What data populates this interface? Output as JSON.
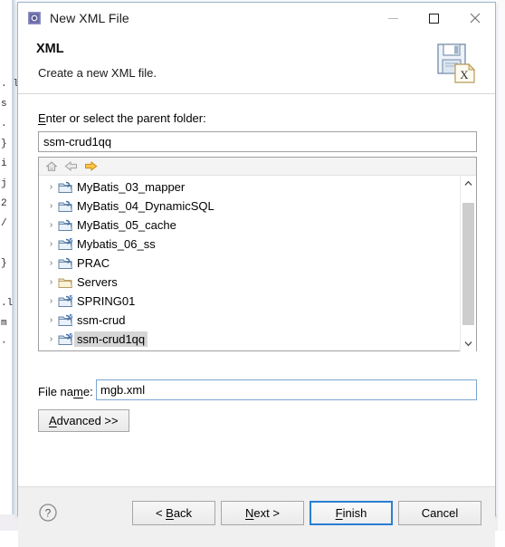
{
  "backdrop": {
    "lines": [
      ". l",
      "s",
      ".",
      "}",
      "",
      "i",
      "j",
      "2",
      "/",
      "",
      "}",
      "",
      "",
      ".l",
      "m",
      "·"
    ]
  },
  "window": {
    "icon": "xml-file-icon",
    "title": "New XML File",
    "controls": {
      "minimize": "minimize-icon",
      "maximize": "maximize-icon",
      "close": "close-icon"
    }
  },
  "header": {
    "title": "XML",
    "description": "Create a new XML file.",
    "icon": "xml-save-banner-icon"
  },
  "parent_folder": {
    "label_prefix": "E",
    "label_rest": "nter or select the parent folder:",
    "value": "ssm-crud1qq"
  },
  "tree_toolbar": {
    "home": "home-icon",
    "back": "back-arrow-icon",
    "forward": "forward-arrow-icon"
  },
  "tree": {
    "items": [
      {
        "label": "MyBatis_03_mapper",
        "icon": "java-project-folder-icon",
        "badge": false,
        "selected": false,
        "twisty": "›"
      },
      {
        "label": "MyBatis_04_DynamicSQL",
        "icon": "java-project-folder-icon",
        "badge": false,
        "selected": false,
        "twisty": "›"
      },
      {
        "label": "MyBatis_05_cache",
        "icon": "java-project-folder-icon",
        "badge": false,
        "selected": false,
        "twisty": "›"
      },
      {
        "label": "Mybatis_06_ss",
        "icon": "java-project-folder-icon",
        "badge": true,
        "selected": false,
        "twisty": "›"
      },
      {
        "label": "PRAC",
        "icon": "java-project-folder-icon",
        "badge": false,
        "selected": false,
        "twisty": "›"
      },
      {
        "label": "Servers",
        "icon": "plain-folder-icon",
        "badge": false,
        "selected": false,
        "twisty": "›"
      },
      {
        "label": "SPRING01",
        "icon": "java-project-folder-icon",
        "badge": true,
        "selected": false,
        "twisty": "›"
      },
      {
        "label": "ssm-crud",
        "icon": "java-project-folder-icon",
        "badge": true,
        "selected": false,
        "twisty": "›"
      },
      {
        "label": "ssm-crud1qq",
        "icon": "java-project-folder-icon",
        "badge": true,
        "selected": true,
        "twisty": "›"
      }
    ]
  },
  "scrollbar": {
    "up": "chevron-up-icon",
    "down": "chevron-down-icon"
  },
  "file_name": {
    "label_a": "File na",
    "label_m": "m",
    "label_b": "e:",
    "value": "mgb.xml"
  },
  "advanced": {
    "mnemonic": "A",
    "rest": "dvanced >>"
  },
  "footer": {
    "help": "help-icon",
    "back": {
      "a": "< ",
      "b": "B",
      "c": "ack"
    },
    "next": {
      "a": "",
      "b": "N",
      "c": "ext >"
    },
    "finish": {
      "a": "",
      "b": "F",
      "c": "inish"
    },
    "cancel": {
      "a": "",
      "b": "",
      "c": "Cancel"
    }
  },
  "colors": {
    "accent": "#2a7fd4",
    "selection": "#d6d6d6",
    "dialog_border": "#9eb6cd",
    "footer_bg": "#f0f0f0"
  }
}
